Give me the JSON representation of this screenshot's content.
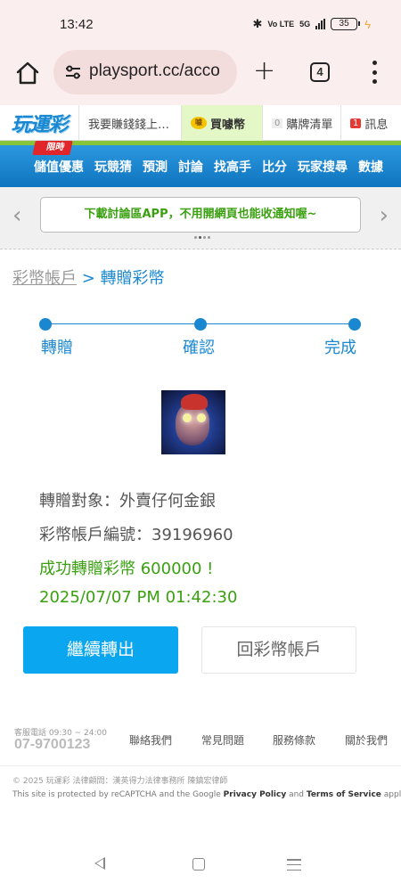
{
  "status_bar": {
    "time": "13:42",
    "network": "5G",
    "volte": "Vo LTE",
    "battery": "35"
  },
  "browser": {
    "url": "playsport.cc/acco",
    "tab_count": "4"
  },
  "site_header": {
    "logo": "玩運彩",
    "earn_link": "我要賺錢錢上…",
    "coin_link": "買噱幣",
    "coin_icon_text": "噱",
    "cart_count": "0",
    "cart_label": "購牌清單",
    "msg_count": "1",
    "msg_label": "訊息"
  },
  "nav": {
    "limited_tag": "限時",
    "items": [
      "儲值優惠",
      "玩競猜",
      "預測",
      "討論",
      "找高手",
      "比分",
      "玩家搜尋",
      "數據"
    ]
  },
  "banner": {
    "text": "下載討論區APP，不用開網頁也能收通知喔~"
  },
  "breadcrumb": {
    "parent": "彩幣帳戶",
    "separator": ">",
    "current": "轉贈彩幣"
  },
  "steps": [
    {
      "label": "轉贈"
    },
    {
      "label": "確認"
    },
    {
      "label": "完成"
    }
  ],
  "transfer": {
    "target": "轉贈對象：外賣仔何金銀",
    "account": "彩幣帳戶編號：39196960",
    "success": "成功轉贈彩幣 600000 !",
    "datetime": "2025/07/07 PM 01:42:30"
  },
  "buttons": {
    "continue": "繼續轉出",
    "back": "回彩幣帳戶"
  },
  "footer": {
    "cs_label": "客服電話 09:30 ~ 24:00",
    "cs_phone": "07-9700123",
    "links": [
      "聯絡我們",
      "常見問題",
      "服務條款",
      "關於我們"
    ],
    "copyright": "© 2025 玩運彩 法律顧問：漢英得力法律事務所 陳鎮宏律師",
    "recaptcha_prefix": "This site is protected by reCAPTCHA and the Google ",
    "privacy": "Privacy Policy",
    "and": " and ",
    "terms": "Terms of Service",
    "suffix": " apply."
  }
}
